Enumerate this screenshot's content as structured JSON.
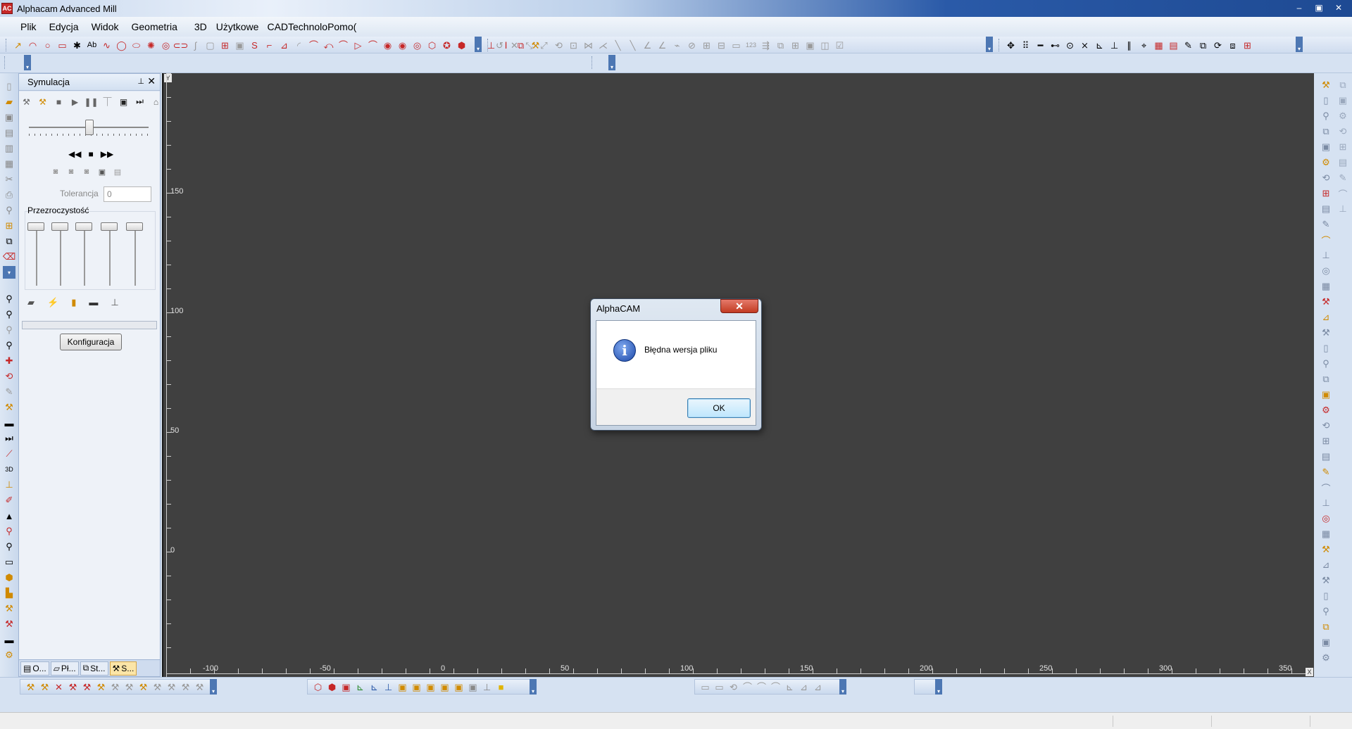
{
  "window": {
    "title": "Alphacam Advanced Mill",
    "icon_text": "AC"
  },
  "window_controls": [
    "–",
    "▣",
    "✕"
  ],
  "menu": [
    "Plik",
    "Edycja",
    "Widok",
    "Geometria",
    "3D",
    "Użytkowe",
    "CADTechnolo",
    "Pomo("
  ],
  "simulation_panel": {
    "title": "Symulacja",
    "tolerance_label": "Tolerancja",
    "tolerance_value": "0",
    "transparency_label": "Przezroczystość",
    "config_button": "Konfiguracja",
    "tabs": [
      "O...",
      "Pł...",
      "St...",
      "S..."
    ]
  },
  "canvas": {
    "background": "#404040",
    "y_axis_labels": [
      "150",
      "100",
      "50",
      "0"
    ],
    "x_axis_labels": [
      "-100",
      "-50",
      "0",
      "50",
      "100",
      "150",
      "200",
      "250",
      "300",
      "350"
    ],
    "y_corner": "Y",
    "x_corner": "X"
  },
  "dialog": {
    "title": "AlphaCAM",
    "message": "Błędna wersja pliku",
    "ok_label": "OK",
    "icon": "info-icon"
  },
  "colors": {
    "accent": "#2a5aa8",
    "canvas": "#404040",
    "panel": "#dfe8f4"
  }
}
